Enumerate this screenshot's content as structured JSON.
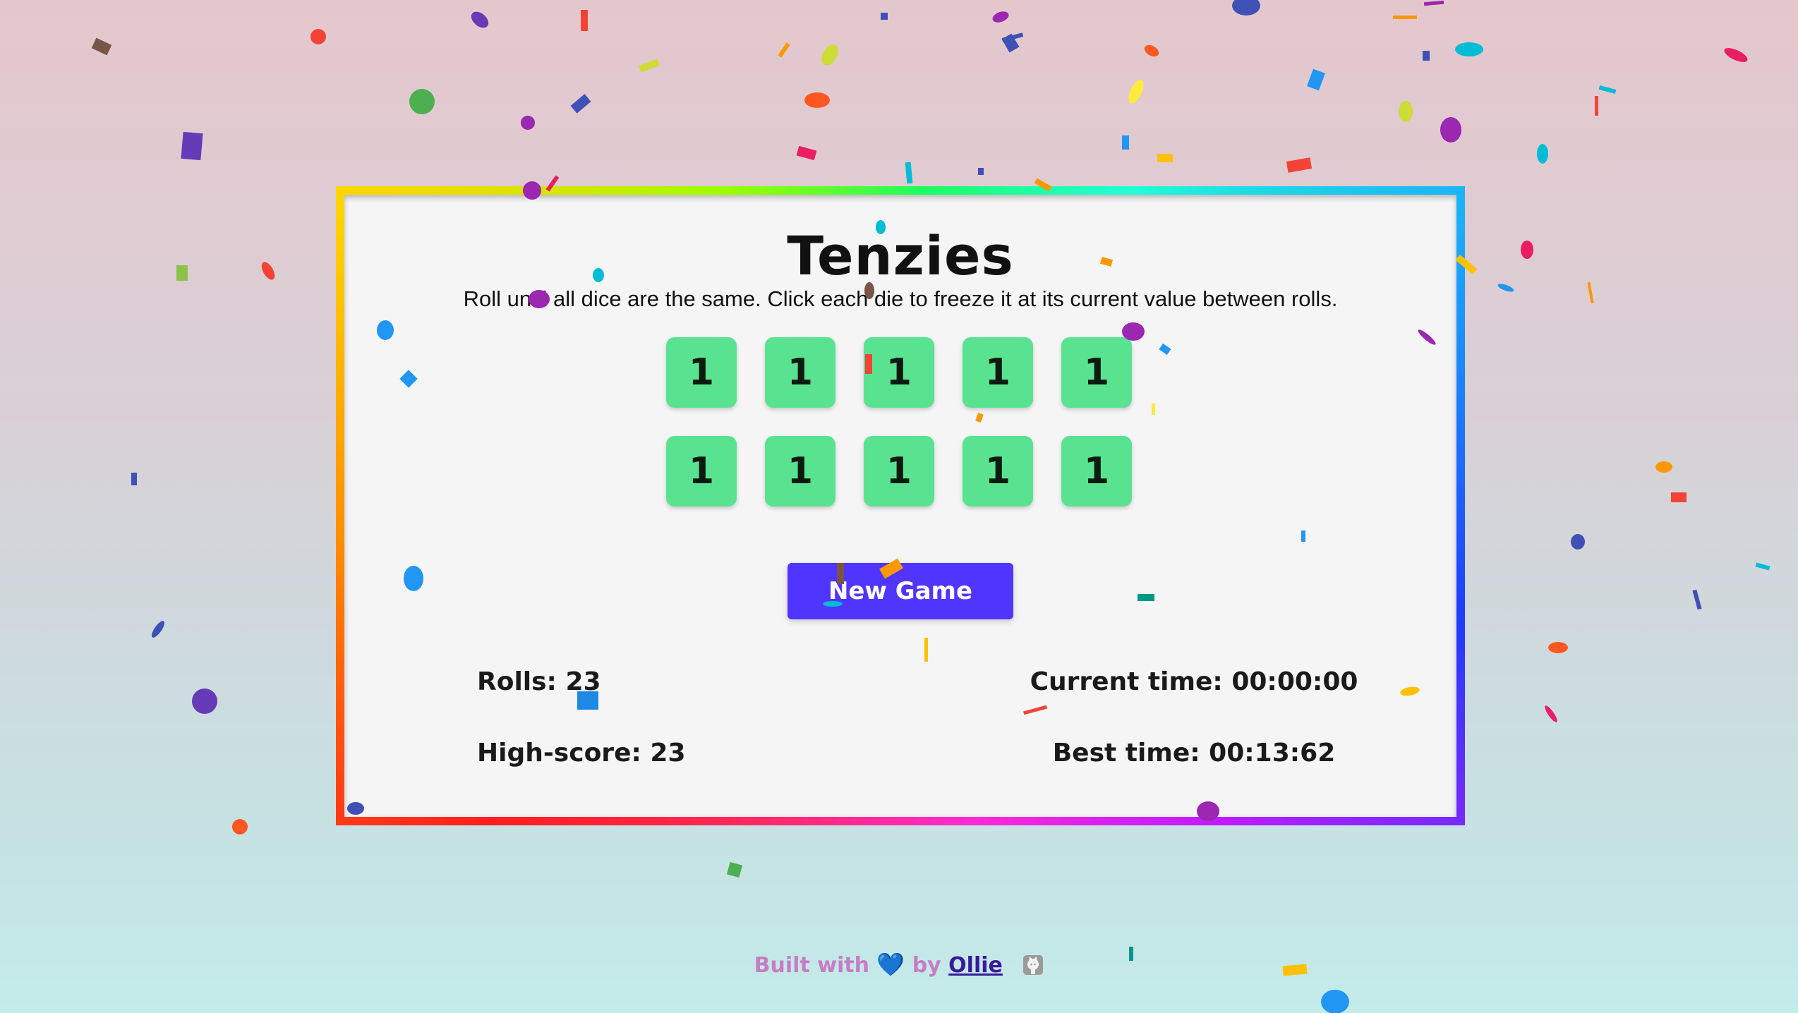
{
  "app": {
    "title": "Tenzies",
    "instructions": "Roll until all dice are the same. Click each die to freeze it at its current value between rolls."
  },
  "dice": [
    {
      "value": "1"
    },
    {
      "value": "1"
    },
    {
      "value": "1"
    },
    {
      "value": "1"
    },
    {
      "value": "1"
    },
    {
      "value": "1"
    },
    {
      "value": "1"
    },
    {
      "value": "1"
    },
    {
      "value": "1"
    },
    {
      "value": "1"
    }
  ],
  "controls": {
    "new_game_label": "New Game"
  },
  "stats": {
    "rolls": "Rolls: 23",
    "high_score": "High-score: 23",
    "current_time": "Current time: 00:00:00",
    "best_time": "Best time: 00:13:62"
  },
  "footer": {
    "built_with": "Built with",
    "heart": "💙",
    "by": "by",
    "author": "Ollie",
    "github_icon": "github-icon"
  },
  "colors": {
    "die_green": "#59e391",
    "button_purple": "#5035ff",
    "footer_pink": "#c77dc4",
    "author_link": "#3a1a9a"
  }
}
